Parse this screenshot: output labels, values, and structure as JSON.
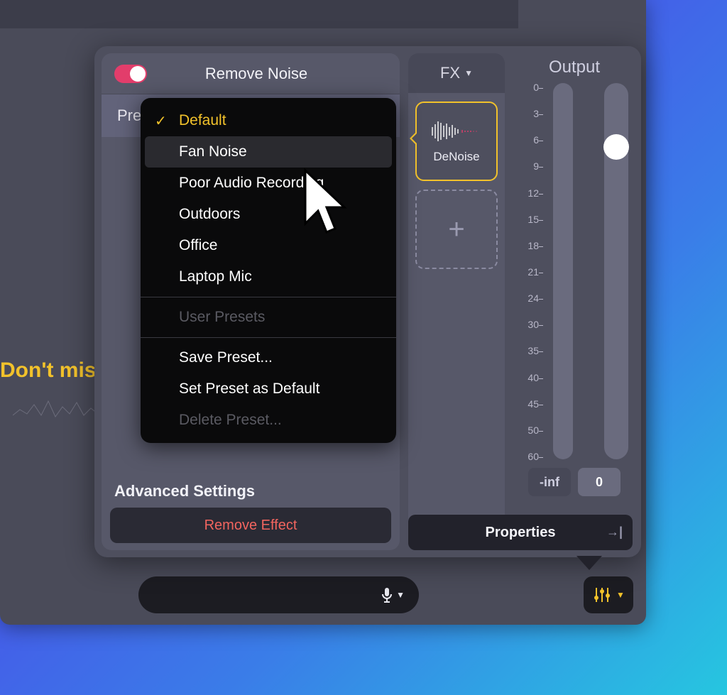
{
  "background_caption": "Don't mis",
  "panel": {
    "effect": {
      "title": "Remove Noise",
      "toggle_on": true,
      "preset_label": "Pre",
      "advanced_label": "Advanced Settings",
      "remove_label": "Remove Effect",
      "dropdown": {
        "items": [
          {
            "label": "Default",
            "selected": true
          },
          {
            "label": "Fan Noise",
            "hover": true
          },
          {
            "label": "Poor Audio Recording"
          },
          {
            "label": "Outdoors"
          },
          {
            "label": "Office"
          },
          {
            "label": "Laptop Mic"
          }
        ],
        "section_label": "User Presets",
        "actions": [
          {
            "label": "Save Preset..."
          },
          {
            "label": "Set Preset as Default"
          },
          {
            "label": "Delete Preset...",
            "disabled": true
          }
        ]
      }
    },
    "fx": {
      "header": "FX",
      "slot_label": "DeNoise"
    },
    "output": {
      "title": "Output",
      "scale": [
        "0",
        "3",
        "6",
        "9",
        "12",
        "15",
        "18",
        "21",
        "24",
        "30",
        "35",
        "40",
        "45",
        "50",
        "60"
      ],
      "readout_left": "-inf",
      "readout_right": "0"
    },
    "properties_label": "Properties"
  }
}
